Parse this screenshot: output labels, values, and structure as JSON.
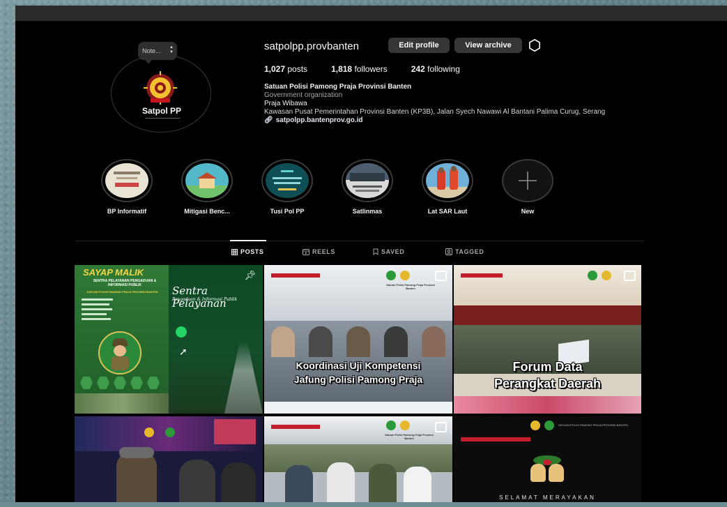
{
  "profile": {
    "username": "satpolpp.provbanten",
    "note_placeholder": "Note...",
    "avatar_text": "Satpol PP",
    "edit_profile_label": "Edit profile",
    "view_archive_label": "View archive",
    "stats": {
      "posts_count": "1,027",
      "posts_label": "posts",
      "followers_count": "1,818",
      "followers_label": "followers",
      "following_count": "242",
      "following_label": "following"
    },
    "bio": {
      "name": "Satuan Polisi Pamong Praja Provinsi Banten",
      "category": "Government organization",
      "motto": "Praja Wibawa",
      "address": "Kawasan Pusat Pemerintahan Provinsi Banten (KP3B), Jalan Syech Nawawi Al Bantani Palima Curug, Serang",
      "link": "satpolpp.bantenprov.go.id"
    }
  },
  "highlights": [
    {
      "label": "BP Informatif",
      "icon": "document-thumbnail"
    },
    {
      "label": "Mitigasi Benc...",
      "icon": "house-thumbnail"
    },
    {
      "label": "Tusi Pol PP",
      "icon": "teal-thumbnail"
    },
    {
      "label": "Satlinmas",
      "icon": "group-photo-thumbnail"
    },
    {
      "label": "Lat SAR Laut",
      "icon": "rescue-photo-thumbnail"
    },
    {
      "label": "New",
      "icon": "plus-icon"
    }
  ],
  "tabs": [
    {
      "label": "POSTS",
      "icon": "grid-icon",
      "active": true
    },
    {
      "label": "REELS",
      "icon": "reels-icon",
      "active": false
    },
    {
      "label": "SAVED",
      "icon": "bookmark-icon",
      "active": false
    },
    {
      "label": "TAGGED",
      "icon": "tagged-icon",
      "active": false
    }
  ],
  "posts": [
    {
      "header": "SAYAP MALIK",
      "subheader": "SENTRA PELAYANAN PENGADUAN & INFORMASI PUBLIK",
      "org": "SATUAN POLISI PAMONG PRAJA PROVINSI BANTEN",
      "script_title": "Sentra Pelayanan",
      "script_sub": "Pengaduan & Informasi Publik",
      "icon": "pin-icon"
    },
    {
      "title_line1": "Koordinasi Uji Kompetensi",
      "title_line2": "Jafung Polisi Pamong Praja",
      "org": "Satuan Polisi Pamong Praja Provinsi Banten",
      "icon": "multi-post-icon"
    },
    {
      "title_line1": "Forum Data",
      "title_line2": "Perangkat Daerah",
      "icon": "multi-post-icon"
    },
    {
      "icon": "none"
    },
    {
      "org": "Satuan Polisi Pamong Praja Provinsi Banten",
      "icon": "multi-post-icon"
    },
    {
      "org": "SATUAN POLISI PAMONG PRAJA PROVINSI BANTEN",
      "greeting": "SELAMAT MERAYAKAN"
    }
  ],
  "colors": {
    "background": "#000000",
    "button": "#363636",
    "muted_text": "#a8a8a8",
    "divider": "#262626"
  }
}
